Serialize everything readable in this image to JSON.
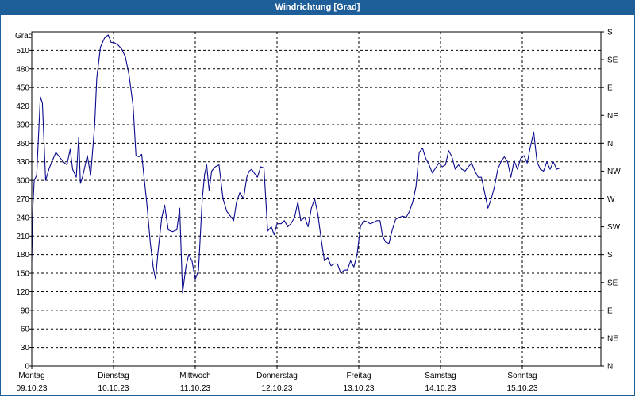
{
  "window": {
    "title": "Windrichtung [Grad]"
  },
  "chart_data": {
    "type": "line",
    "title": "Windrichtung [Grad]",
    "ylabel": "Grad",
    "ylim": [
      0,
      540
    ],
    "grid": true,
    "yticks": [
      0,
      30,
      60,
      90,
      120,
      150,
      180,
      210,
      240,
      270,
      300,
      330,
      360,
      390,
      420,
      450,
      480,
      510
    ],
    "right_ticks": [
      {
        "value": 0,
        "label": "N"
      },
      {
        "value": 45,
        "label": "NE"
      },
      {
        "value": 90,
        "label": "E"
      },
      {
        "value": 135,
        "label": "SE"
      },
      {
        "value": 180,
        "label": "S"
      },
      {
        "value": 225,
        "label": "SW"
      },
      {
        "value": 270,
        "label": "W"
      },
      {
        "value": 315,
        "label": "NW"
      },
      {
        "value": 360,
        "label": "N"
      },
      {
        "value": 405,
        "label": "NE"
      },
      {
        "value": 450,
        "label": "E"
      },
      {
        "value": 495,
        "label": "SE"
      },
      {
        "value": 540,
        "label": "S"
      }
    ],
    "xlim": [
      0,
      7
    ],
    "xticks": [
      {
        "value": 0,
        "day": "Montag",
        "date": "09.10.23"
      },
      {
        "value": 1,
        "day": "Dienstag",
        "date": "10.10.23"
      },
      {
        "value": 2,
        "day": "Mittwoch",
        "date": "11.10.23"
      },
      {
        "value": 3,
        "day": "Donnerstag",
        "date": "12.10.23"
      },
      {
        "value": 4,
        "day": "Freitag",
        "date": "13.10.23"
      },
      {
        "value": 5,
        "day": "Samstag",
        "date": "14.10.23"
      },
      {
        "value": 6,
        "day": "Sonntag",
        "date": "15.10.23"
      }
    ],
    "series": [
      {
        "color": "#0a0a8c",
        "points": [
          [
            0.0,
            170
          ],
          [
            0.015,
            260
          ],
          [
            0.03,
            300
          ],
          [
            0.06,
            308
          ],
          [
            0.105,
            435
          ],
          [
            0.13,
            425
          ],
          [
            0.17,
            300
          ],
          [
            0.215,
            320
          ],
          [
            0.295,
            345
          ],
          [
            0.355,
            335
          ],
          [
            0.385,
            330
          ],
          [
            0.43,
            325
          ],
          [
            0.47,
            350
          ],
          [
            0.5,
            318
          ],
          [
            0.545,
            305
          ],
          [
            0.575,
            370
          ],
          [
            0.595,
            295
          ],
          [
            0.62,
            305
          ],
          [
            0.68,
            340
          ],
          [
            0.72,
            308
          ],
          [
            0.77,
            390
          ],
          [
            0.795,
            465
          ],
          [
            0.84,
            515
          ],
          [
            0.89,
            530
          ],
          [
            0.935,
            535
          ],
          [
            0.97,
            523
          ],
          [
            1.015,
            522
          ],
          [
            1.06,
            518
          ],
          [
            1.1,
            512
          ],
          [
            1.145,
            500
          ],
          [
            1.19,
            470
          ],
          [
            1.24,
            420
          ],
          [
            1.275,
            340
          ],
          [
            1.31,
            338
          ],
          [
            1.345,
            342
          ],
          [
            1.41,
            260
          ],
          [
            1.45,
            200
          ],
          [
            1.485,
            160
          ],
          [
            1.515,
            140
          ],
          [
            1.545,
            185
          ],
          [
            1.59,
            240
          ],
          [
            1.625,
            260
          ],
          [
            1.67,
            220
          ],
          [
            1.72,
            217
          ],
          [
            1.775,
            220
          ],
          [
            1.81,
            255
          ],
          [
            1.845,
            118
          ],
          [
            1.885,
            160
          ],
          [
            1.92,
            180
          ],
          [
            1.96,
            170
          ],
          [
            2.0,
            140
          ],
          [
            2.04,
            155
          ],
          [
            2.085,
            270
          ],
          [
            2.115,
            310
          ],
          [
            2.14,
            325
          ],
          [
            2.17,
            283
          ],
          [
            2.2,
            315
          ],
          [
            2.245,
            322
          ],
          [
            2.29,
            325
          ],
          [
            2.34,
            270
          ],
          [
            2.385,
            250
          ],
          [
            2.43,
            242
          ],
          [
            2.47,
            235
          ],
          [
            2.505,
            265
          ],
          [
            2.545,
            280
          ],
          [
            2.59,
            270
          ],
          [
            2.63,
            305
          ],
          [
            2.66,
            315
          ],
          [
            2.69,
            318
          ],
          [
            2.72,
            312
          ],
          [
            2.76,
            305
          ],
          [
            2.8,
            322
          ],
          [
            2.84,
            320
          ],
          [
            2.885,
            218
          ],
          [
            2.93,
            225
          ],
          [
            2.965,
            212
          ],
          [
            3.0,
            230
          ],
          [
            3.05,
            230
          ],
          [
            3.09,
            235
          ],
          [
            3.13,
            225
          ],
          [
            3.17,
            230
          ],
          [
            3.215,
            240
          ],
          [
            3.255,
            265
          ],
          [
            3.29,
            235
          ],
          [
            3.34,
            240
          ],
          [
            3.38,
            225
          ],
          [
            3.42,
            255
          ],
          [
            3.46,
            270
          ],
          [
            3.5,
            245
          ],
          [
            3.54,
            205
          ],
          [
            3.58,
            170
          ],
          [
            3.62,
            175
          ],
          [
            3.66,
            162
          ],
          [
            3.7,
            165
          ],
          [
            3.74,
            165
          ],
          [
            3.78,
            150
          ],
          [
            3.82,
            155
          ],
          [
            3.86,
            155
          ],
          [
            3.9,
            170
          ],
          [
            3.94,
            160
          ],
          [
            3.98,
            180
          ],
          [
            4.02,
            225
          ],
          [
            4.06,
            235
          ],
          [
            4.1,
            233
          ],
          [
            4.14,
            230
          ],
          [
            4.18,
            232
          ],
          [
            4.22,
            235
          ],
          [
            4.26,
            235
          ],
          [
            4.29,
            210
          ],
          [
            4.33,
            200
          ],
          [
            4.37,
            198
          ],
          [
            4.41,
            220
          ],
          [
            4.45,
            237
          ],
          [
            4.49,
            240
          ],
          [
            4.54,
            242
          ],
          [
            4.58,
            240
          ],
          [
            4.62,
            250
          ],
          [
            4.66,
            265
          ],
          [
            4.7,
            290
          ],
          [
            4.74,
            345
          ],
          [
            4.78,
            352
          ],
          [
            4.82,
            335
          ],
          [
            4.86,
            325
          ],
          [
            4.9,
            312
          ],
          [
            4.94,
            320
          ],
          [
            4.98,
            328
          ],
          [
            5.02,
            322
          ],
          [
            5.06,
            325
          ],
          [
            5.1,
            348
          ],
          [
            5.14,
            338
          ],
          [
            5.18,
            318
          ],
          [
            5.22,
            325
          ],
          [
            5.26,
            318
          ],
          [
            5.3,
            315
          ],
          [
            5.34,
            322
          ],
          [
            5.38,
            328
          ],
          [
            5.42,
            315
          ],
          [
            5.46,
            305
          ],
          [
            5.5,
            305
          ],
          [
            5.54,
            280
          ],
          [
            5.58,
            255
          ],
          [
            5.62,
            270
          ],
          [
            5.66,
            290
          ],
          [
            5.7,
            318
          ],
          [
            5.74,
            330
          ],
          [
            5.78,
            338
          ],
          [
            5.82,
            330
          ],
          [
            5.86,
            305
          ],
          [
            5.9,
            332
          ],
          [
            5.94,
            318
          ],
          [
            5.98,
            335
          ],
          [
            6.02,
            340
          ],
          [
            6.06,
            328
          ],
          [
            6.1,
            355
          ],
          [
            6.14,
            378
          ],
          [
            6.18,
            330
          ],
          [
            6.22,
            318
          ],
          [
            6.26,
            315
          ],
          [
            6.3,
            330
          ],
          [
            6.34,
            318
          ],
          [
            6.38,
            330
          ],
          [
            6.42,
            318
          ],
          [
            6.46,
            320
          ]
        ]
      }
    ]
  }
}
